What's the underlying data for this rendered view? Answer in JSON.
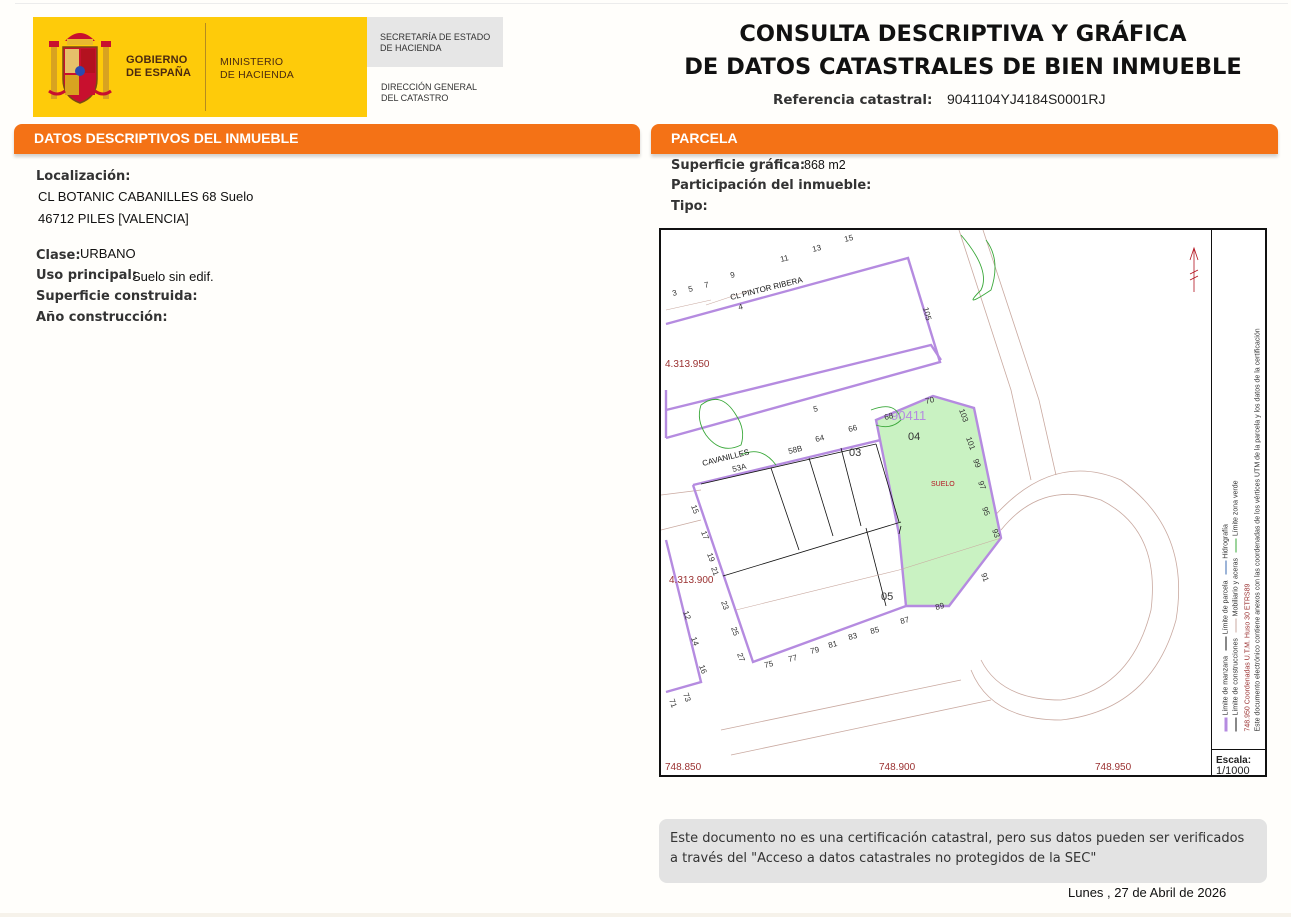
{
  "header": {
    "gobierno": "GOBIERNO\nDE ESPAÑA",
    "ministerio": "MINISTERIO\nDE HACIENDA",
    "secretaria": "SECRETARÍA DE ESTADO\nDE HACIENDA",
    "direccion": "DIRECCIÓN GENERAL\nDEL CATASTRO",
    "title_line1": "CONSULTA DESCRIPTIVA Y GRÁFICA",
    "title_line2": "DE DATOS CATASTRALES DE BIEN INMUEBLE",
    "ref_label": "Referencia catastral:",
    "ref_value": "9041104YJ4184S0001RJ"
  },
  "descriptivos": {
    "header": "DATOS DESCRIPTIVOS DEL INMUEBLE",
    "localizacion_label": "Localización:",
    "localizacion_line1": "CL BOTANIC CABANILLES 68 Suelo",
    "localizacion_line2": "46712 PILES [VALENCIA]",
    "clase_label": "Clase:",
    "clase_value": "URBANO",
    "uso_label": "Uso principal:",
    "uso_value": "Suelo sin edif.",
    "superficie_label": "Superficie construida:",
    "anio_label": "Año construcción:"
  },
  "parcela": {
    "header": "PARCELA",
    "superficie_label": "Superficie gráfica:",
    "superficie_value": "868 m2",
    "participacion_label": "Participación del inmueble:",
    "tipo_label": "Tipo:"
  },
  "map": {
    "street_pintor": "CL PINTOR RIBERA",
    "street_cavanilles": "CAVANILLES",
    "parcel_label": "SUELO",
    "parcel_id": "90411",
    "sub_03": "03",
    "sub_04": "04",
    "sub_05": "05",
    "coord_y1": "4.313.950",
    "coord_y2": "4.313.900",
    "coord_x1": "748.850",
    "coord_x2": "748.900",
    "coord_x3": "748.950",
    "numbers_top": [
      "3",
      "5",
      "7",
      "9",
      "11",
      "13",
      "15",
      "4",
      "105"
    ],
    "numbers_mid": [
      "5",
      "70",
      "68",
      "66",
      "64",
      "58B",
      "53A",
      "103",
      "101",
      "99",
      "97",
      "95",
      "93",
      "91"
    ],
    "numbers_left": [
      "15",
      "17",
      "19",
      "21",
      "23",
      "25",
      "27",
      "12",
      "14",
      "16",
      "71",
      "73"
    ],
    "numbers_bottom": [
      "75",
      "77",
      "79",
      "81",
      "83",
      "85",
      "87",
      "89"
    ],
    "legend_col1_a": "Límite de manzana",
    "legend_col1_b": "Límite de parcela",
    "legend_col1_c": "Hidrografía",
    "legend_col2_a": "Límite de construcciones",
    "legend_col2_b": "Mobiliario y aceras",
    "legend_col2_c": "Límite zona verde",
    "legend_col3_a": "748.950 Coordenadas U.T.M. Huso 30 ETRS89",
    "legend_col3_b": "Este documento electrónico contiene anexos con las coordenadas de los vértices UTM de la parcela y los datos de la certificación",
    "scale_label": "Escala:",
    "scale_value": "1/1000"
  },
  "notice": "Este documento no es una certificación catastral, pero sus datos pueden ser verificados a través del \"Acceso a datos catastrales no protegidos de la SEC\"",
  "date": "Lunes , 27 de Abril de 2026",
  "colors": {
    "orange": "#f47216",
    "yellow": "#fecb0a",
    "parcel_fill": "#c9f2c2",
    "block_line": "#b58be0",
    "coord_text": "#9a3030",
    "green_zone": "#3aa83a"
  }
}
